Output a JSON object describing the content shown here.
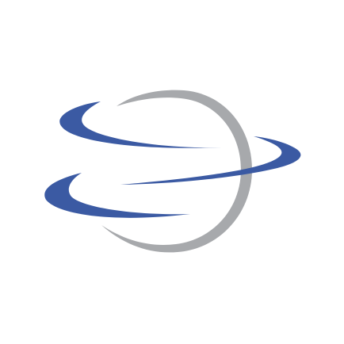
{
  "logo": {
    "icon": "globe-swoosh-icon",
    "colors": {
      "background": "#ffffff",
      "ring": "#a7a9ac",
      "swoosh": "#3b5aa3"
    }
  }
}
